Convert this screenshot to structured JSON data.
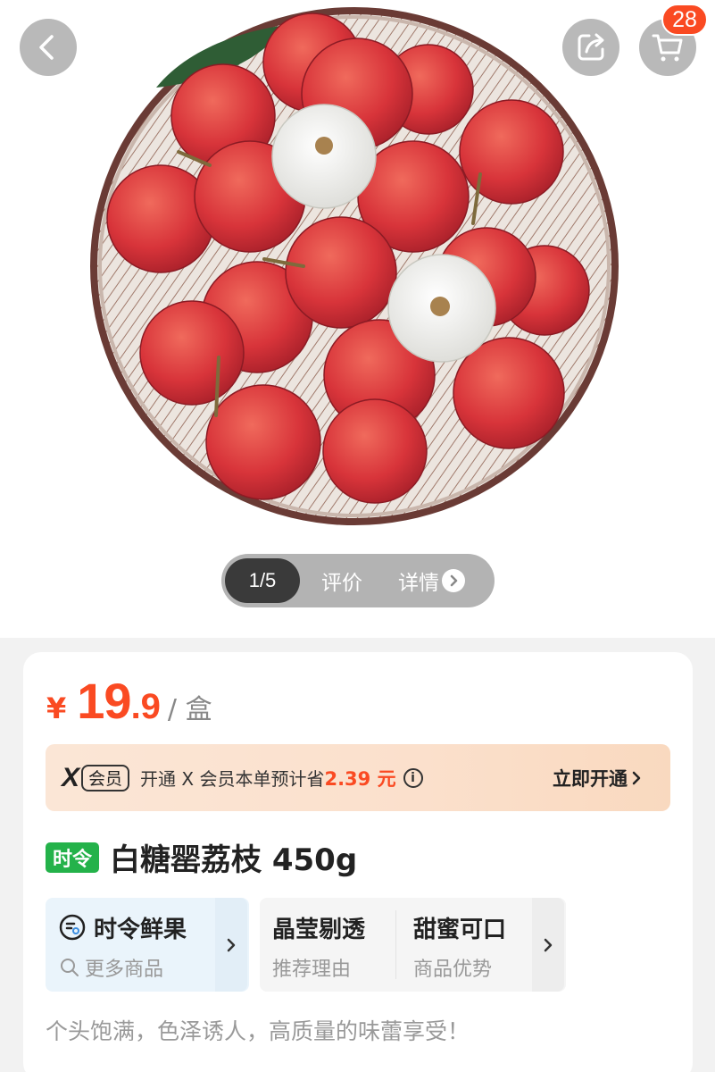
{
  "header": {
    "back_icon": "chevron-left-icon",
    "share_icon": "share-icon",
    "cart_icon": "shopping-cart-icon",
    "cart_count": "28"
  },
  "gallery": {
    "index": "1/5",
    "tab_reviews": "评价",
    "tab_details": "详情"
  },
  "price": {
    "symbol": "¥",
    "integer": "19",
    "decimal": ".9",
    "unit": "/ 盒",
    "color": "#fa4a22"
  },
  "membership": {
    "logo": "X",
    "tag": "会员",
    "text": "开通 X 会员本单预计省",
    "savings": "2.39 元",
    "cta": "立即开通"
  },
  "product": {
    "badge": "时令",
    "title": "白糖罂荔枝 450g",
    "badge_color": "#24b24a"
  },
  "features": {
    "seasonal": {
      "title": "时令鲜果",
      "sub": "更多商品"
    },
    "points": [
      {
        "title": "晶莹剔透",
        "sub": "推荐理由"
      },
      {
        "title": "甜蜜可口",
        "sub": "商品优势"
      }
    ]
  },
  "tagline": "个头饱满，色泽诱人，高质量的味蕾享受！"
}
